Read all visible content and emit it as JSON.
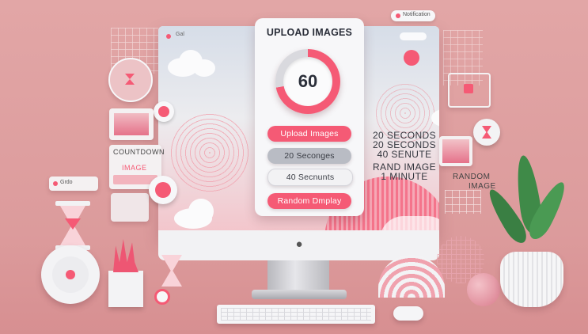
{
  "notification": {
    "text": "Notification"
  },
  "window": {
    "tab_label": "Gal"
  },
  "panel": {
    "title": "UPLOAD IMAGES",
    "timer_value": "60",
    "timer_progress": 0.72
  },
  "buttons": {
    "upload": "Upload Images",
    "interval_20": "20 Seconges",
    "interval_40": "40 Secnunts",
    "random": "Random Dmplay"
  },
  "right_options": {
    "line1": "20 SECONDS",
    "line2": "20 SECONDS",
    "line3": "40 SENUTE",
    "line4": "RAND IMAGE",
    "line5": "1 MINUTE"
  },
  "side_labels": {
    "countdown": "COUNTDOWN",
    "image": "IMAGE",
    "random": "RANDOM",
    "random_image": "IMAGE",
    "small_card": "Grdo"
  },
  "colors": {
    "accent": "#f55a75",
    "background": "#dc9b9c",
    "neutral_button": "#b9bcc4"
  },
  "icons": {
    "apple": "apple-logo-icon",
    "hourglass": "hourglass-icon",
    "clock": "alarm-clock-icon"
  }
}
